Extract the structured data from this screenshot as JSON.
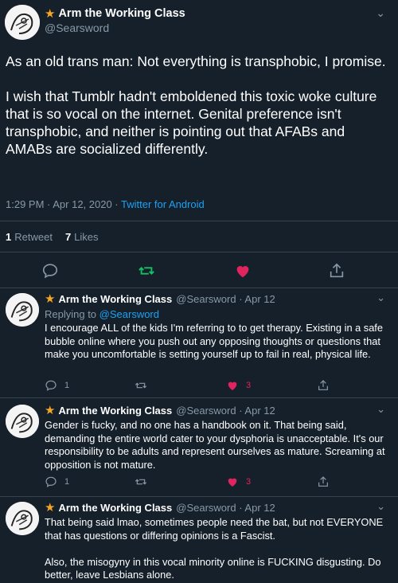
{
  "colors": {
    "background": "#15202b",
    "text": "#ffffff",
    "muted": "#8899a6",
    "link": "#1da1f2",
    "retweet_green": "#17bf63",
    "like_red": "#e0245e",
    "star": "#f5a623"
  },
  "main_tweet": {
    "display_name": "Arm the Working Class",
    "handle": "@Searsword",
    "text": "As an old trans man: Not everything is transphobic, I promise.\n\nI wish that Tumblr hadn't emboldened this toxic woke culture that is so vocal on the internet. Genital preference isn't transphobic, and neither is pointing out that AFABs and AMABs are socialized differently.",
    "time": "1:29 PM · Apr 12, 2020 · ",
    "source": "Twitter for Android",
    "retweets_count": "1",
    "retweets_label": "Retweet",
    "likes_count": "7",
    "likes_label": "Likes",
    "icons": [
      "reply-icon",
      "retweet-icon",
      "like-icon",
      "share-icon"
    ]
  },
  "replies": [
    {
      "display_name": "Arm the Working Class",
      "handle_date": "@Searsword · Apr 12",
      "replying_prefix": "Replying to ",
      "replying_handle": "@Searsword",
      "text": "I encourage ALL of the kids I'm referring to to get therapy. Existing in a safe bubble online where you push out any opposing thoughts or questions that make you uncomfortable is setting yourself up to fail in real, physical life.",
      "reply_count": "1",
      "like_count": "3"
    },
    {
      "display_name": "Arm the Working Class",
      "handle_date": "@Searsword · Apr 12",
      "text": "Gender is fucky, and no one has a handbook on it. That being said, demanding the entire world cater to your dysphoria is unacceptable. It's our responsibility to be adults and represent ourselves as mature. Screaming at opposition is not mature.",
      "reply_count": "1",
      "like_count": "3"
    },
    {
      "display_name": "Arm the Working Class",
      "handle_date": "@Searsword · Apr 12",
      "text": "That being said lmao, sometimes people need the bat, but not EVERYONE that has questions or differing opinions is a Fascist.\n\nAlso, the misogyny in this vocal minority online is FUCKING disgusting. Do better, leave Lesbians alone."
    }
  ]
}
